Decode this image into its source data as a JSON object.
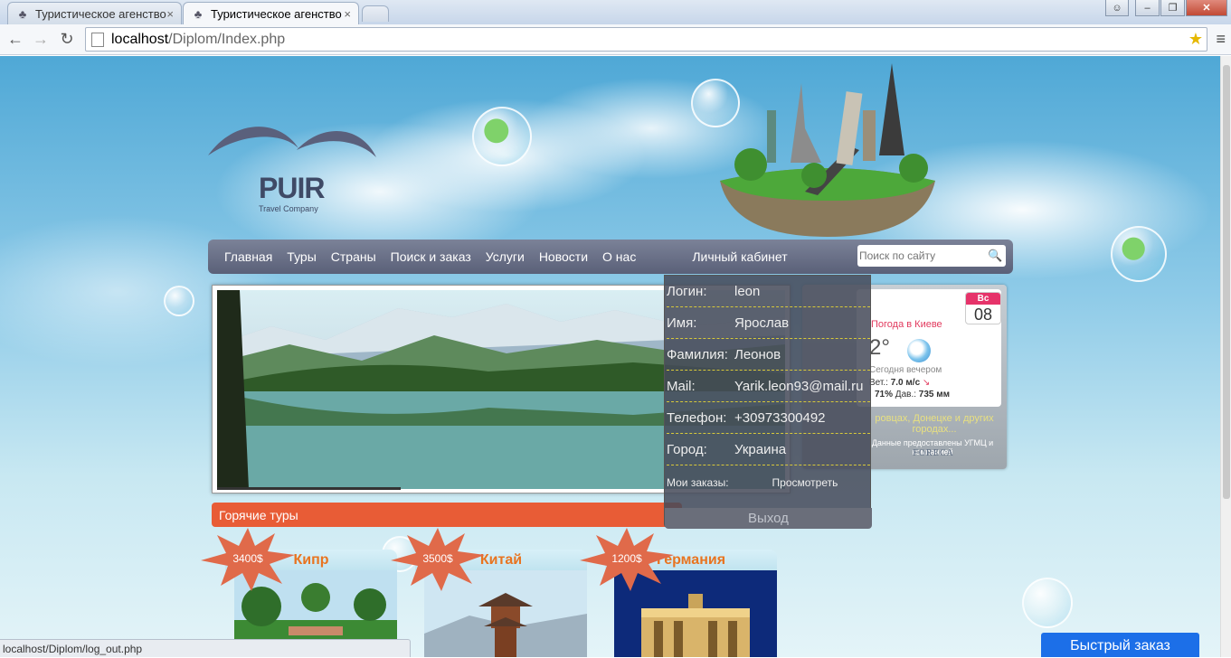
{
  "browser": {
    "tabs": [
      {
        "title": "Туристическое агенство",
        "active": false
      },
      {
        "title": "Туристическое агенство",
        "active": true
      }
    ],
    "url_host": "localhost",
    "url_path": "/Diplom/Index.php",
    "status_url": "localhost/Diplom/log_out.php"
  },
  "logo": {
    "brand": "PUIR",
    "tagline": "Travel Company"
  },
  "nav": {
    "items": [
      "Главная",
      "Туры",
      "Страны",
      "Поиск и заказ",
      "Услуги",
      "Новости",
      "О нас"
    ],
    "cabinet": "Личный кабинет",
    "search_placeholder": "Поиск по сайту"
  },
  "account": {
    "rows": [
      {
        "label": "Логин:",
        "value": "leon"
      },
      {
        "label": "Имя:",
        "value": "Ярослав"
      },
      {
        "label": "Фамилия:",
        "value": "Леонов"
      },
      {
        "label": "Mail:",
        "value": "Yarik.leon93@mail.ru"
      },
      {
        "label": "Телефон:",
        "value": "+30973300492"
      },
      {
        "label": "Город:",
        "value": "Украина"
      }
    ],
    "orders_label": "Мои заказы:",
    "orders_link": "Просмотреть",
    "logout": "Выход"
  },
  "weather": {
    "day_of_week": "Вс",
    "day": "08",
    "title": "Погода в Киеве",
    "temp": "2°",
    "condition": "Сегодня вечером",
    "wind_label": "Вет.:",
    "wind": "7.0 м/с",
    "humidity": "71%",
    "pressure_label": "Дав.:",
    "pressure": "735 мм",
    "note": "ровцах, Донецке и других городах...",
    "source": "Данные предоставлены УГМЦ и компанией",
    "provider": "FORECA"
  },
  "hot_tours": {
    "title": "Горячие туры",
    "items": [
      {
        "name": "Кипр",
        "price": "3400$"
      },
      {
        "name": "Китай",
        "price": "3500$"
      },
      {
        "name": "Германия",
        "price": "1200$"
      }
    ]
  },
  "quick_order": "Быстрый заказ",
  "colors": {
    "accent_orange": "#e85c36",
    "nav_bg": "#6b7189",
    "quick_order": "#1c6fe8"
  }
}
